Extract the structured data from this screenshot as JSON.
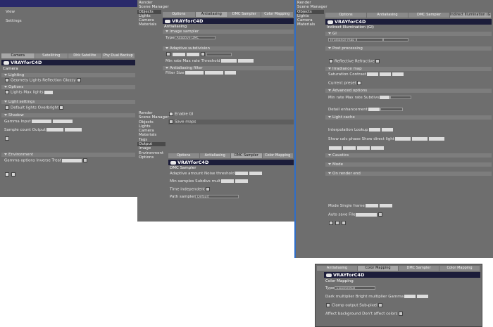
{
  "colors": {
    "window_bg": "#6e6e6e",
    "logo_bar": "#1c1d3a",
    "accent_border": "#2f6ec8",
    "desktop": "#ffffff"
  },
  "w1": {
    "menu": [
      "View",
      "Settings"
    ],
    "tabs": [
      "Camera",
      "Satelliting",
      "Dhk Satellite",
      "Phy Dual Backup"
    ],
    "logo": "VRAYforC4D",
    "title": "Camera",
    "sections": [
      "Lighting",
      "Options",
      "Light settings",
      "Shadow",
      "Environment"
    ],
    "rows": [
      "Geomety  Lights  Reflection  Glossy",
      "Lights  Max lights",
      "Default lights  Overbright",
      "Gamma  Input",
      "Sample count  Output",
      "Gamma options  Inverse  Treat"
    ]
  },
  "w2": {
    "sidebar": [
      "Render",
      "Scene Manager",
      "Objects",
      "Lights",
      "Camera",
      "Materials",
      "Tags",
      "Output",
      "Image",
      "Environment"
    ],
    "tabs": [
      "Options",
      "Antialiasing",
      "DMC Sampler",
      "Color Mapping"
    ],
    "logo": "VRAYforC4D",
    "title": "Antialiasing",
    "sections": [
      "Image sampler",
      "Adaptive subdivision",
      "Antialiasing filter"
    ],
    "rows": [
      "Type",
      "Adaptive DMC",
      "Min rate  Max rate  Threshold",
      "Filter  Size",
      "Show samples"
    ]
  },
  "w3": {
    "sidebar": [
      "Render",
      "Scene Manager",
      "Objects",
      "Lights",
      "Camera",
      "Materials",
      "Tags",
      "Output",
      "Image",
      "Environment",
      "Options",
      "Color",
      "Output",
      "Render"
    ],
    "checks": [
      "Enable GI",
      "Save maps"
    ],
    "tabs": [
      "Options",
      "Antialiasing",
      "DMC Sampler",
      "Color Mapping"
    ],
    "logo": "VRAYforC4D",
    "title": "DMC Sampler",
    "rows": [
      "Adaptive amount  Noise threshold",
      "Min samples  Subdivs mult",
      "Time independent",
      "Path sampler"
    ],
    "path_value": "Default"
  },
  "w4": {
    "sidebar": [
      "Render",
      "Scene Manager",
      "Objects",
      "Lights",
      "Camera",
      "Materials",
      "Tags",
      "Output",
      "Image",
      "Environment"
    ],
    "tabs": [
      "Options",
      "Antialiasing",
      "DMC Sampler",
      "Indirect Illumination (GI)"
    ],
    "logo": "VRAYforC4D",
    "title": "Indirect Illumination (GI)",
    "engine": "Irradiance map",
    "sections": [
      "GI",
      "Post processing",
      "Irradiance map",
      "Advanced options",
      "Light cache",
      "Caustics",
      "Mode",
      "On render end"
    ],
    "rows": [
      "Primary bounces  Secondary",
      "Reflective  Refractive",
      "Saturation  Contrast",
      "Current preset",
      "Min rate  Max rate  Subdivs",
      "Detail enhancement",
      "Interpolation  Lookup",
      "Show calc phase  Show direct light",
      "Mode  Single frame",
      "Auto save  File"
    ]
  },
  "w5": {
    "tabs": [
      "Antialiasing",
      "Color Mapping",
      "DMC Sampler",
      "Color Mapping"
    ],
    "logo": "VRAYforC4D",
    "title": "Color Mapping",
    "type": "Exponential",
    "rows": [
      "Type",
      "Dark multiplier  Bright multiplier  Gamma",
      "Clamp output  Sub-pixel",
      "Affect background  Don't affect colors"
    ]
  }
}
